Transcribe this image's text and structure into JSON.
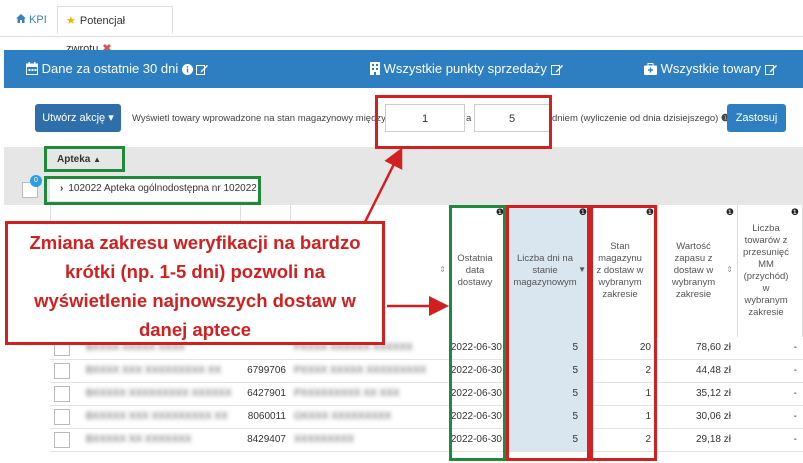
{
  "tabs": [
    {
      "label": "KPI",
      "icon": "home-icon"
    },
    {
      "label": "Potencjał zwrotu",
      "icon": "star-icon"
    }
  ],
  "filters": {
    "period": "Dane za ostatnie 30 dni",
    "points": "Wszystkie punkty sprzedaży",
    "goods": "Wszystkie towary"
  },
  "action": {
    "create_label": "Utwórz akcję",
    "range_prefix": "Wyświetl towary wprowadzone na stan magazynowy między:",
    "from": "1",
    "and": "a",
    "to": "5",
    "range_suffix": "dniem (wyliczenie od dnia dzisiejszego)",
    "apply_label": "Zastosuj"
  },
  "group": {
    "title": "Apteka",
    "badge": "0",
    "pharmacy": "102022 Apteka ogólnodostępna nr 102022"
  },
  "columns": {
    "delivery_date": "Ostatnia data dostawy",
    "days_in_stock": "Liczba dni na stanie magazynowym",
    "stock_range": "Stan magazynu z dostaw w wybranym zakresie",
    "stock_value": "Wartość zapasu z dostaw w wybranym zakresie",
    "mm_count": "Liczba towarów z przesunięć MM (przychód) w wybranym zakresie"
  },
  "rows": [
    {
      "name": "BXXXX XXXXX XXXX",
      "code": "",
      "producer": "PXXXX XXXXXX XXXXXX",
      "date": "2022-06-30",
      "days": "5",
      "stock": "20",
      "value": "78,60 zł",
      "mm": "-"
    },
    {
      "name": "BXXXX XXX XXXXXXXXX XX",
      "code": "6799706",
      "producer": "PXXXX XXXXX XXXXXXXXX",
      "date": "2022-06-30",
      "days": "5",
      "stock": "2",
      "value": "44,48 zł",
      "mm": "-"
    },
    {
      "name": "BXXXXX XXXXXXXXX XXXXXX",
      "code": "6427901",
      "producer": "PXXXXXXXXX XX XXX",
      "date": "2022-06-30",
      "days": "5",
      "stock": "1",
      "value": "35,12 zł",
      "mm": "-"
    },
    {
      "name": "BXXXXX XXX XXXXXXXXX XX",
      "code": "8060011",
      "producer": "OXXXX XXXXXXXXX",
      "date": "2022-06-30",
      "days": "5",
      "stock": "1",
      "value": "30,06 zł",
      "mm": "-"
    },
    {
      "name": "BXXXXX XX XXXXXXX",
      "code": "8429407",
      "producer": "XXXXXXXXX",
      "date": "2022-06-30",
      "days": "5",
      "stock": "2",
      "value": "29,18 zł",
      "mm": "-"
    }
  ],
  "annotation": {
    "text": "Zmiana zakresu weryfikacji na bardzo krótki (np. 1-5 dni) pozwoli na wyświetlenie najnowszych dostaw w danej aptece"
  },
  "colors": {
    "primary": "#2e7fc2",
    "annotation_red": "#d21f1f",
    "annotation_green": "#1f8a3a",
    "sorted_column": "#d9e5ef"
  }
}
